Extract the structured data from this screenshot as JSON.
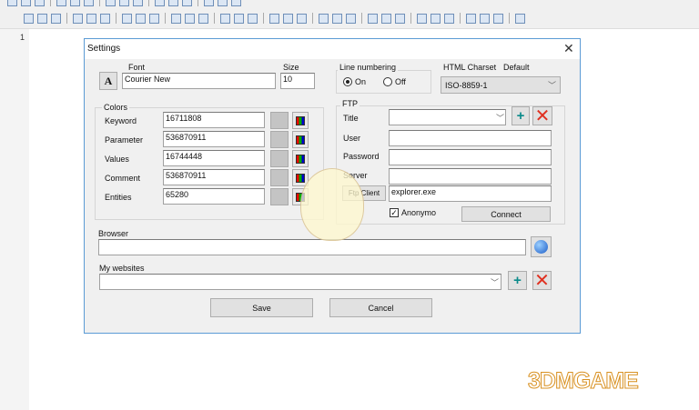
{
  "toolbar": {
    "row1": [
      "new-icon",
      "open-icon",
      "save-icon",
      "cut-icon",
      "bold-icon",
      "italic-icon",
      "underline-icon",
      "list-icon",
      "align-icon",
      "image-icon",
      "table-icon",
      "link-icon",
      "color-icon",
      "palette-icon",
      "tool-icon"
    ],
    "row2": [
      "frame-top-icon",
      "frame-bottom-icon",
      "frames-icon",
      "form-icon",
      "textbox-icon",
      "table-grid-icon",
      "delete-table-icon",
      "insert-col-icon",
      "insert-row-icon",
      "split-icon",
      "merge-icon",
      "col-left-icon",
      "col-right-icon",
      "row-add-icon",
      "row-del-icon",
      "layer-icon",
      "textfield-icon",
      "button-icon",
      "image-button-icon",
      "blank-icon",
      "list-box-icon",
      "tree-icon",
      "select-icon",
      "input-icon",
      "radio-icon",
      "checkbox-icon",
      "php-icon",
      "validate-icon",
      "tag-icon",
      "tools-icon",
      "font-icon"
    ]
  },
  "editor": {
    "line_number": "1"
  },
  "dialog": {
    "title": "Settings",
    "font": {
      "label": "Font",
      "button": "A",
      "value": "Courier New",
      "size_label": "Size",
      "size": "10"
    },
    "colors": {
      "label": "Colors",
      "rows": [
        {
          "label": "Keyword",
          "value": "16711808"
        },
        {
          "label": "Parameter",
          "value": "536870911"
        },
        {
          "label": "Values",
          "value": "16744448"
        },
        {
          "label": "Comment",
          "value": "536870911"
        },
        {
          "label": "Entities",
          "value": "65280"
        }
      ]
    },
    "line_numbering": {
      "label": "Line numbering",
      "on": "On",
      "off": "Off",
      "selected": "On"
    },
    "charset": {
      "label": "HTML Charset",
      "default_label": "Default",
      "value": "ISO-8859-1"
    },
    "ftp": {
      "label": "FTP",
      "title_label": "Title",
      "title_value": "",
      "user_label": "User",
      "password_label": "Password",
      "server_label": "Server",
      "client_button": "Ftp Client",
      "client_value": "explorer.exe",
      "anonymous_label": "Anonymo",
      "anonymous_checked": true,
      "connect": "Connect"
    },
    "browser": {
      "label": "Browser",
      "value": ""
    },
    "websites": {
      "label": "My websites",
      "value": ""
    },
    "save": "Save",
    "cancel": "Cancel"
  },
  "watermark": "3DMGAME"
}
